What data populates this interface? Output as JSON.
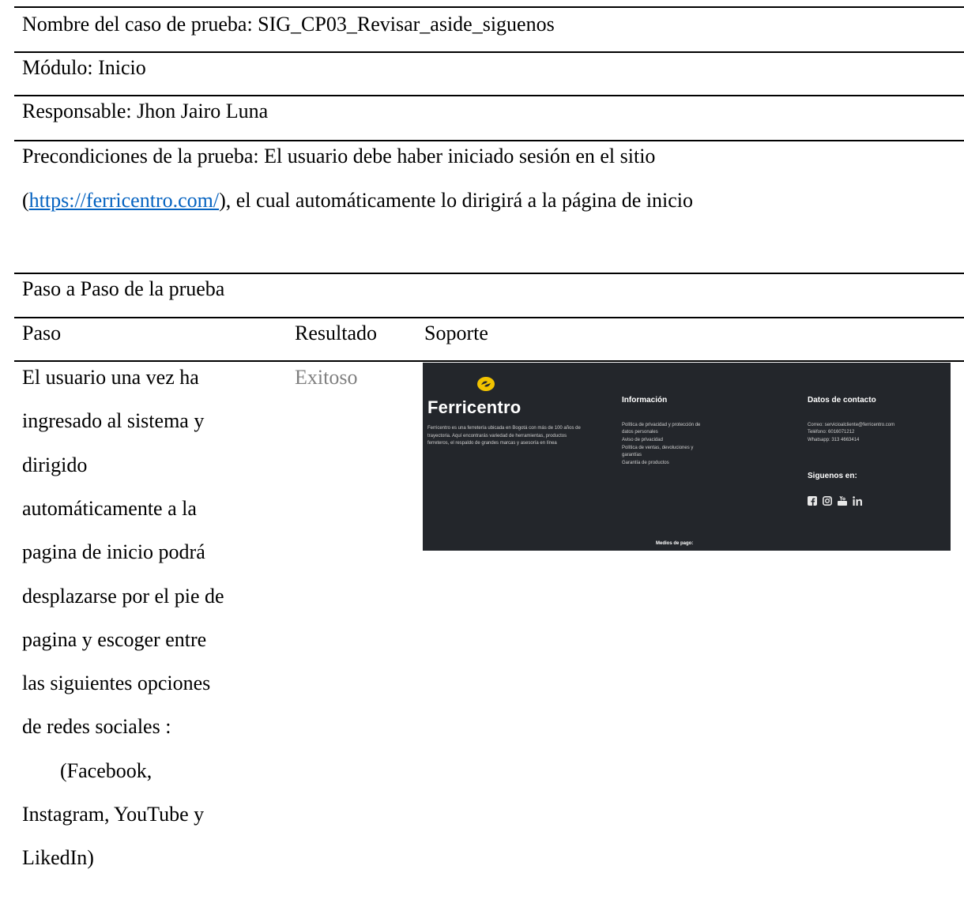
{
  "header": {
    "test_name": "Nombre del caso de prueba: SIG_CP03_Revisar_aside_siguenos",
    "module": "Módulo: Inicio",
    "responsible": "Responsable: Jhon Jairo Luna",
    "preconditions_prefix": "Precondiciones de la prueba: El usuario debe haber iniciado sesión en el sitio",
    "precond_open": "(",
    "precond_link": "https://ferricentro.com/",
    "precond_rest": "), el cual automáticamente lo dirigirá a la página de inicio"
  },
  "steps_section": {
    "title": "Paso a Paso de la prueba",
    "columns": [
      "Paso",
      "Resultado",
      "Soporte"
    ],
    "row": {
      "step_lines": [
        "El usuario una vez ha",
        "ingresado al sistema y",
        "dirigido",
        "automáticamente a la",
        "pagina de inicio podrá",
        "desplazarse por el pie de",
        "pagina y escoger entre",
        "las siguientes opciones",
        "de redes sociales :",
        "(Facebook,",
        "Instagram, YouTube y",
        "LikedIn)"
      ],
      "result": "Exitoso",
      "result_color": "#7f7f7f"
    }
  },
  "screenshot": {
    "brand": "Ferricentro",
    "brand_color": "#f2c300",
    "background": "#23262b",
    "description": "Ferricentro es una ferretería ubicada en Bogotá con más de 100 años de trayectoria. Aquí encontrarás variedad de herramientas, productos ferreteros, el respaldo de grandes marcas y asesoría en línea",
    "info_title": "Información",
    "info_items": [
      "Política de privacidad y protección de",
      "datos personales",
      "Aviso de privacidad",
      "Política de ventas, devoluciones y",
      "garantías",
      "Garantía de productos"
    ],
    "contact_title": "Datos de contacto",
    "contact_items": [
      "Correo: servicioalcliente@ferricentro.com",
      "Teléfono: 6016071212",
      "Whatsapp: 313 4663414"
    ],
    "follow_title": "Siguenos en:",
    "social_icons": [
      "facebook-icon",
      "instagram-icon",
      "youtube-icon",
      "linkedin-icon"
    ],
    "payment_title": "Medios de pago:"
  }
}
